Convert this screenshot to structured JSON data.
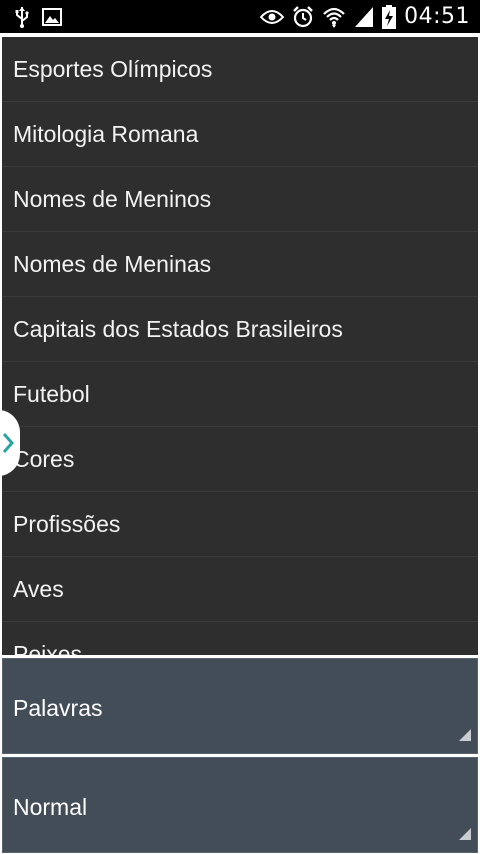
{
  "status_bar": {
    "time": "04:51",
    "icons": [
      "usb-icon",
      "image-icon",
      "eye-icon",
      "alarm-icon",
      "wifi-icon",
      "signal-icon",
      "battery-charging-icon"
    ]
  },
  "list": {
    "items": [
      "Esportes Olímpicos",
      "Mitologia Romana",
      "Nomes de Meninos",
      "Nomes de Meninas",
      "Capitais dos Estados Brasileiros",
      "Futebol",
      "Cores",
      "Profissões",
      "Aves",
      "Peixes"
    ]
  },
  "spinners": {
    "mode_label": "Palavras",
    "difficulty_label": "Normal"
  },
  "colors": {
    "list_bg": "#2e2e2e",
    "spinner_bg": "#434d58",
    "handle_chevron": "#2aa3a3"
  }
}
